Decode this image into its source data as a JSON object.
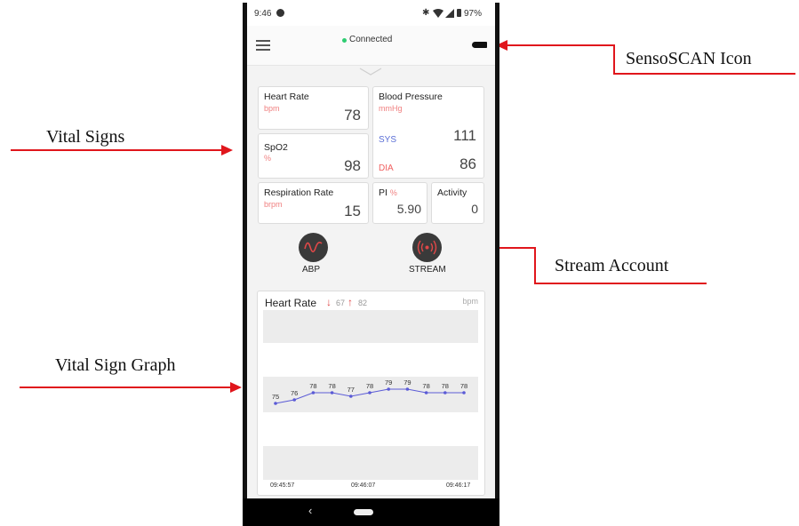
{
  "annotations": {
    "sensoscan_icon": "SensoSCAN Icon",
    "vital_signs": "Vital Signs",
    "stream_account": "Stream Account",
    "vital_sign_graph": "Vital Sign Graph"
  },
  "status_bar": {
    "time": "9:46",
    "battery": "97%"
  },
  "app_bar": {
    "connection_status": "Connected",
    "status_color": "#2ecc71"
  },
  "vitals": {
    "heart_rate": {
      "title": "Heart Rate",
      "unit": "bpm",
      "value": "78"
    },
    "blood_pressure": {
      "title": "Blood Pressure",
      "unit": "mmHg",
      "sys_label": "SYS",
      "sys_value": "111",
      "dia_label": "DIA",
      "dia_value": "86"
    },
    "spo2": {
      "title": "SpO2",
      "unit": "%",
      "value": "98"
    },
    "respiration_rate": {
      "title": "Respiration Rate",
      "unit": "brpm",
      "value": "15"
    },
    "pi": {
      "title": "PI",
      "unit": "%",
      "value": "5.90"
    },
    "activity": {
      "title": "Activity",
      "value": "0"
    }
  },
  "actions": {
    "abp_label": "ABP",
    "stream_label": "STREAM"
  },
  "graph": {
    "title": "Heart Rate",
    "min_value": "67",
    "max_value": "82",
    "unit": "bpm",
    "accent": "#5b5bd6"
  },
  "chart_data": {
    "type": "line",
    "title": "Heart Rate",
    "ylabel": "bpm",
    "x_ticks": [
      "09:45:57",
      "09:46:07",
      "09:46:17"
    ],
    "values": [
      75,
      76,
      78,
      78,
      77,
      78,
      79,
      79,
      78,
      78,
      78
    ]
  }
}
